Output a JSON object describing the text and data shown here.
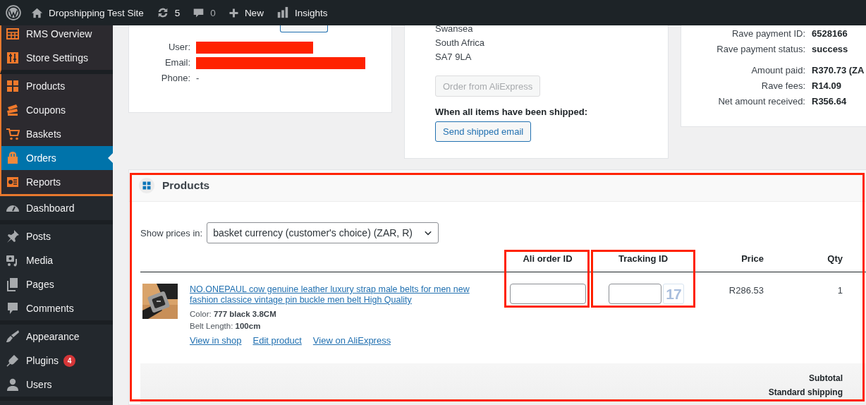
{
  "admin_bar": {
    "site_name": "Dropshipping Test Site",
    "updates": "5",
    "comments": "0",
    "new_label": "New",
    "insights_label": "Insights"
  },
  "sidebar": {
    "sections": [
      {
        "kind": "plugin",
        "items": [
          {
            "label": "RMS Overview",
            "selected": false
          },
          {
            "label": "Store Settings",
            "selected": false
          }
        ]
      },
      {
        "kind": "plugin",
        "items": [
          {
            "label": "Products",
            "selected": false
          },
          {
            "label": "Coupons",
            "selected": false
          },
          {
            "label": "Baskets",
            "selected": false
          },
          {
            "label": "Orders",
            "selected": true
          },
          {
            "label": "Reports",
            "selected": false
          }
        ]
      },
      {
        "kind": "core",
        "items": [
          {
            "label": "Dashboard",
            "selected": false
          }
        ]
      },
      {
        "kind": "core",
        "items": [
          {
            "label": "Posts",
            "selected": false
          },
          {
            "label": "Media",
            "selected": false
          },
          {
            "label": "Pages",
            "selected": false
          },
          {
            "label": "Comments",
            "selected": false
          }
        ]
      },
      {
        "kind": "core",
        "items": [
          {
            "label": "Appearance",
            "selected": false
          },
          {
            "label": "Plugins",
            "selected": false,
            "badge": "4"
          },
          {
            "label": "Users",
            "selected": false
          }
        ]
      }
    ]
  },
  "customer_card": {
    "redacted_fields": [
      {
        "label": "User:"
      },
      {
        "label": "Email:"
      }
    ],
    "phone": {
      "label": "Phone:",
      "value": "-"
    }
  },
  "shipping_card": {
    "address_lines": [
      "Swansea",
      "South Africa",
      "SA7 9LA"
    ],
    "order_button": {
      "label": "Order from AliExpress",
      "disabled": true
    },
    "shipped_label": "When all items have been shipped:",
    "shipped_button": {
      "label": "Send shipped email",
      "disabled": false
    }
  },
  "payment_card": {
    "groups": [
      [
        {
          "label": "Rave payment ID:",
          "value": "6528166"
        },
        {
          "label": "Rave payment status:",
          "value": "success"
        }
      ],
      [
        {
          "label": "Amount paid:",
          "value": "R370.73 (ZA"
        },
        {
          "label": "Rave fees:",
          "value": "R14.09"
        },
        {
          "label": "Net amount received:",
          "value": "R356.64"
        }
      ]
    ]
  },
  "products_panel": {
    "title": "Products",
    "highlighted": true,
    "price_select": {
      "label": "Show prices in:",
      "value": "basket currency (customer's choice) (ZAR, R)"
    },
    "columns": [
      {
        "label": "Ali order ID",
        "highlighted": true
      },
      {
        "label": "Tracking ID",
        "highlighted": true
      },
      {
        "label": "Price",
        "highlighted": false
      },
      {
        "label": "Qty",
        "highlighted": false
      }
    ],
    "rows": [
      {
        "thumbnail": {
          "kind": "picture"
        },
        "title": "NO.ONEPAUL cow genuine leather luxury strap male belts for men new fashion classice vintage pin buckle men belt High Quality",
        "attributes": [
          {
            "name": "Color:",
            "value": "777 black 3.8CM"
          },
          {
            "name": "Belt Length:",
            "value": "100cm"
          }
        ],
        "links": [
          "View in shop",
          "Edit product",
          "View on AliExpress"
        ],
        "tracking_button": "17",
        "price": "R286.53",
        "qty": "1"
      }
    ],
    "totals": [
      "Subtotal",
      "Standard shipping"
    ]
  }
}
